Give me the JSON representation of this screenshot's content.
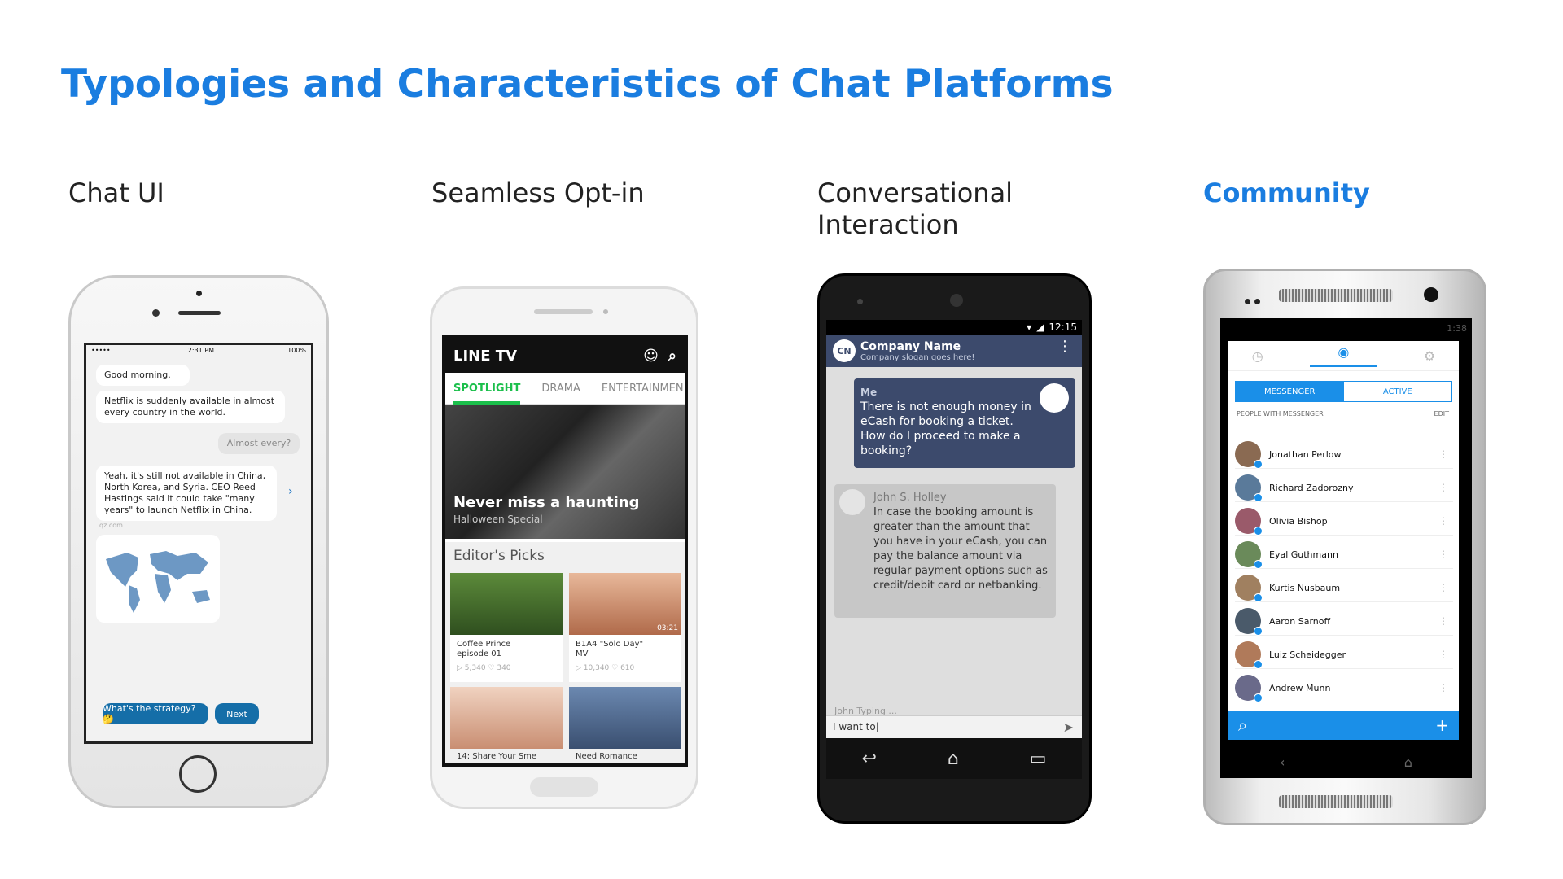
{
  "title": "Typologies and Characteristics of Chat Platforms",
  "columns": [
    {
      "label": "Chat UI"
    },
    {
      "label": "Seamless Opt-in"
    },
    {
      "label": "Conversational Interaction"
    },
    {
      "label": "Community"
    }
  ],
  "chatui": {
    "status_left": "•••••",
    "status_time": "12:31 PM",
    "status_battery": "100%",
    "greeting": "Good morning.",
    "netflix_msg": "Netflix is suddenly available in almost every country in the world.",
    "user_reply": "Almost every?",
    "china_msg": "Yeah, it's still not available in China, North Korea, and Syria. CEO Reed Hastings said it could take \"many years\" to launch Netflix in China.",
    "source": "qz.com",
    "strategy_btn": "What's the strategy? 🤔",
    "next_btn": "Next"
  },
  "linetv": {
    "logo": "LINE TV",
    "tabs": [
      "SPOTLIGHT",
      "DRAMA",
      "ENTERTAINMEN"
    ],
    "hero_title": "Never miss a haunting",
    "hero_sub": "Halloween Special",
    "section": "Editor's Picks",
    "item1_title": "Coffee Prince episode 01",
    "item1_meta": "▷ 5,340  ♡ 340",
    "item2_title": "B1A4 \"Solo Day\" MV",
    "item2_meta": "▷ 10,340  ♡ 610",
    "item2_duration": "03:21",
    "item3_title": "14: Share Your Sme",
    "item4_title": "Need Romance"
  },
  "convo": {
    "time": "12:15",
    "logo": "CN",
    "company": "Company Name",
    "slogan": "Company slogan goes here!",
    "me_label": "Me",
    "me_msg": "There is not enough money in eCash for booking a ticket. How do I proceed to make a booking?",
    "agent_name": "John S. Holley",
    "agent_msg": "In case the booking amount is greater than the amount that you have in your eCash, you can pay the balance amount via regular payment options such as credit/debit card or netbanking.",
    "typing": "John Typing ...",
    "input_value": "I want to|"
  },
  "community": {
    "status": "1:38",
    "seg_left": "MESSENGER",
    "seg_right": "ACTIVE",
    "section": "PEOPLE WITH MESSENGER",
    "edit": "EDIT",
    "people": [
      "Jonathan Perlow",
      "Richard Zadorozny",
      "Olivia Bishop",
      "Eyal Guthmann",
      "Kurtis Nusbaum",
      "Aaron Sarnoff",
      "Luiz Scheidegger",
      "Andrew Munn"
    ]
  },
  "colors": {
    "accent": "#1a7de0",
    "messenger": "#1a8fe8",
    "line_green": "#1bbf4b",
    "cn_navy": "#3c4a6c"
  }
}
